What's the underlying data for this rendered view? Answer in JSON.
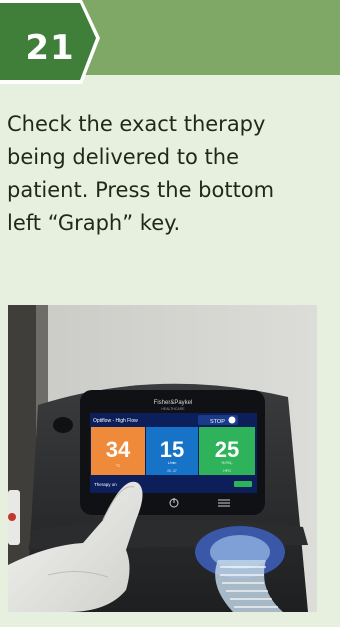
{
  "step": {
    "number": "21"
  },
  "instruction": {
    "lines": [
      "Check the exact therapy",
      "being delivered to the",
      "patient. Press the bottom",
      "left “Graph” key."
    ]
  },
  "device": {
    "brand": "Fisher&Paykel",
    "brand_sub": "HEALTHCARE",
    "mode_label": "Optiflow - High Flow",
    "stop_label": "STOP",
    "temperature": {
      "value": "34",
      "unit": "°C"
    },
    "flow": {
      "value": "15",
      "unit": "L/min",
      "sub": "20..37"
    },
    "oxygen": {
      "value": "25",
      "unit": "% FiO₂",
      "sub": "HFO"
    },
    "status": "Therapy on"
  },
  "colors": {
    "band": "#7fa765",
    "badge": "#3f7f3a",
    "card": "#e7efdf",
    "temp_tile": "#ee8a3a",
    "flow_tile": "#1673c8",
    "oxy_tile": "#2fb35a"
  },
  "icons": {
    "graph_key": "graph-icon",
    "power_key": "power-icon",
    "menu_key": "menu-icon"
  }
}
